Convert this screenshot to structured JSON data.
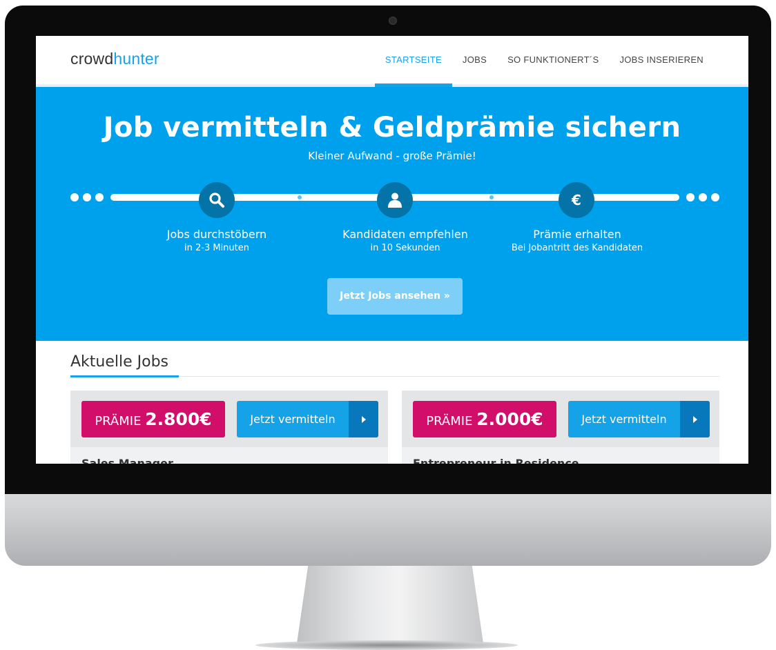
{
  "logo": {
    "part1": "crowd",
    "part2": "hunter"
  },
  "nav": {
    "items": [
      {
        "label": "STARTSEITE"
      },
      {
        "label": "JOBS"
      },
      {
        "label": "SO FUNKTIONERT´S"
      },
      {
        "label": "JOBS INSERIEREN"
      }
    ],
    "active_index": 0
  },
  "hero": {
    "title": "Job vermitteln & Geldprämie sichern",
    "subtitle": "Kleiner Aufwand - große Prämie!",
    "steps": [
      {
        "icon": "search-icon",
        "title": "Jobs durchstöbern",
        "desc": "in 2-3 Minuten"
      },
      {
        "icon": "person-icon",
        "title": "Kandidaten empfehlen",
        "desc": "in 10 Sekunden"
      },
      {
        "icon": "euro-icon",
        "title": "Prämie erhalten",
        "desc": "Bei Jobantritt des Kandidaten"
      }
    ],
    "cta_label": "Jetzt Jobs ansehen »"
  },
  "jobs": {
    "heading": "Aktuelle Jobs",
    "cards": [
      {
        "praemie_label": "PRÄMIE",
        "praemie_amount": "2.800€",
        "button_label": "Jetzt vermitteln",
        "title": "Sales Manager"
      },
      {
        "praemie_label": "PRÄMIE",
        "praemie_amount": "2.000€",
        "button_label": "Jetzt vermitteln",
        "title": "Entrepreneur in Residence"
      }
    ]
  },
  "colors": {
    "brand_blue": "#00a1ec",
    "accent_pink": "#d10f6b",
    "button_blue": "#16a2e6",
    "icon_dark_blue": "#0474a8"
  }
}
